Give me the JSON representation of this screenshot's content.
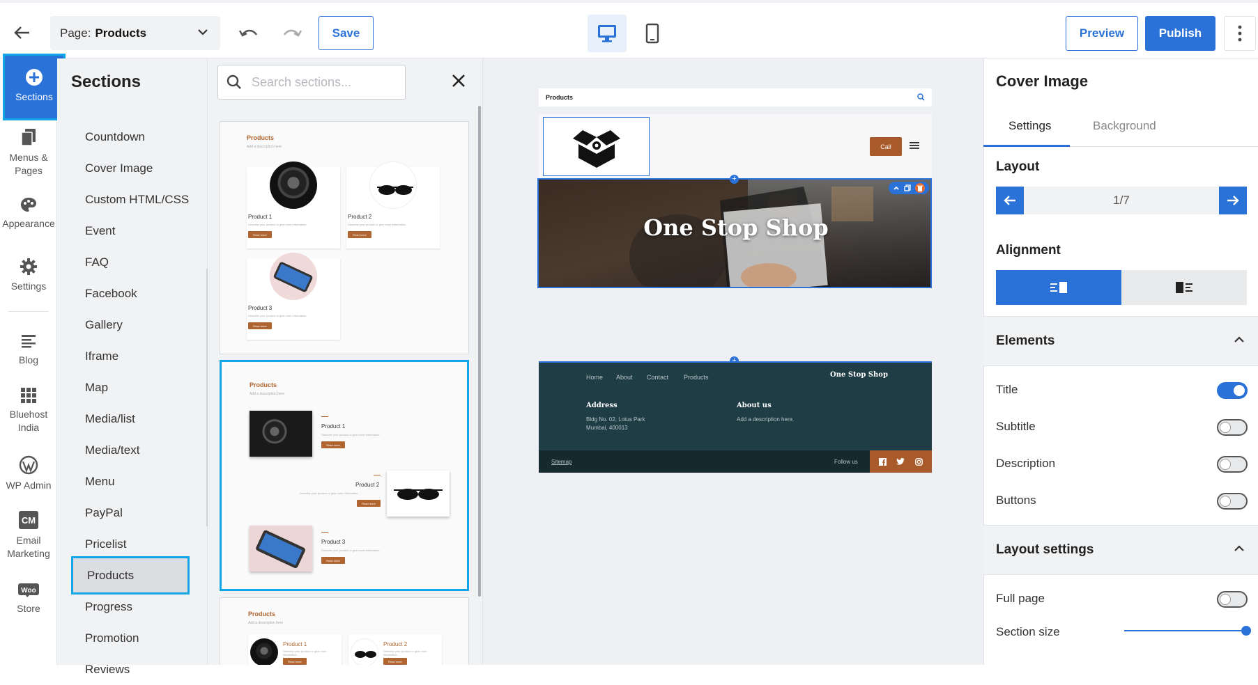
{
  "topbar": {
    "page_label": "Page:",
    "page_value": "Products",
    "save_label": "Save",
    "preview_label": "Preview",
    "publish_label": "Publish"
  },
  "rail": {
    "items": [
      {
        "label": "Sections",
        "icon": "plus-circle-icon"
      },
      {
        "label": "Menus & Pages",
        "icon": "pages-icon"
      },
      {
        "label": "Appearance",
        "icon": "palette-icon"
      },
      {
        "label": "Settings",
        "icon": "gear-icon"
      },
      {
        "label": "Blog",
        "icon": "blog-icon"
      },
      {
        "label": "Bluehost India",
        "icon": "grid-icon"
      },
      {
        "label": "WP Admin",
        "icon": "wordpress-icon"
      },
      {
        "label": "Email Marketing",
        "icon": "cm-icon"
      },
      {
        "label": "Store",
        "icon": "woo-icon"
      }
    ]
  },
  "sections": {
    "title": "Sections",
    "search_placeholder": "Search sections...",
    "items": [
      "Countdown",
      "Cover Image",
      "Custom HTML/CSS",
      "Event",
      "FAQ",
      "Facebook",
      "Gallery",
      "Iframe",
      "Map",
      "Media/list",
      "Media/text",
      "Menu",
      "PayPal",
      "Pricelist",
      "Products",
      "Progress",
      "Promotion",
      "Reviews"
    ],
    "selected": "Products"
  },
  "thumbnails": {
    "t1": {
      "title": "Products",
      "sub": "Add a description here",
      "p1": "Product 1",
      "p2": "Product 2",
      "p3": "Product 3",
      "desc": "Describe your product or give more information.",
      "btn": "Read more"
    },
    "t2": {
      "title": "Products",
      "sub": "Add a description here",
      "p1": "Product 1",
      "p2": "Product 2",
      "p3": "Product 3",
      "desc": "Describe your product or give more information.",
      "btn": "Read more"
    },
    "t3": {
      "title": "Products",
      "sub": "Add a description here",
      "p1": "Product 1",
      "p2": "Product 2",
      "desc": "Describe your product or give more information.",
      "btn": "Read more"
    }
  },
  "canvas": {
    "site_page": "Products",
    "call_label": "Call",
    "hero_title": "One Stop Shop",
    "footer": {
      "nav": [
        "Home",
        "About",
        "Contact",
        "Products"
      ],
      "brand": "One Stop Shop",
      "address_head": "Address",
      "address_line1": "Bldg No. 02, Lotus Park",
      "address_line2": "Mumbai, 400013",
      "about_head": "About us",
      "about_text": "Add a description here.",
      "sitemap": "Sitemap",
      "follow": "Follow us"
    }
  },
  "right_panel": {
    "title": "Cover Image",
    "tabs": [
      "Settings",
      "Background"
    ],
    "layout_label": "Layout",
    "layout_count": "1/7",
    "alignment_label": "Alignment",
    "elements_label": "Elements",
    "elements": [
      {
        "label": "Title",
        "on": true
      },
      {
        "label": "Subtitle",
        "on": false
      },
      {
        "label": "Description",
        "on": false
      },
      {
        "label": "Buttons",
        "on": false
      }
    ],
    "layout_settings_label": "Layout settings",
    "full_page_label": "Full page",
    "full_page_on": false,
    "section_size_label": "Section size",
    "section_size_value": 1.0
  },
  "colors": {
    "accent": "#2a72d8",
    "highlight": "#13a6e6",
    "brand_brown": "#a85a2b",
    "footer_bg": "#1f3d44"
  }
}
